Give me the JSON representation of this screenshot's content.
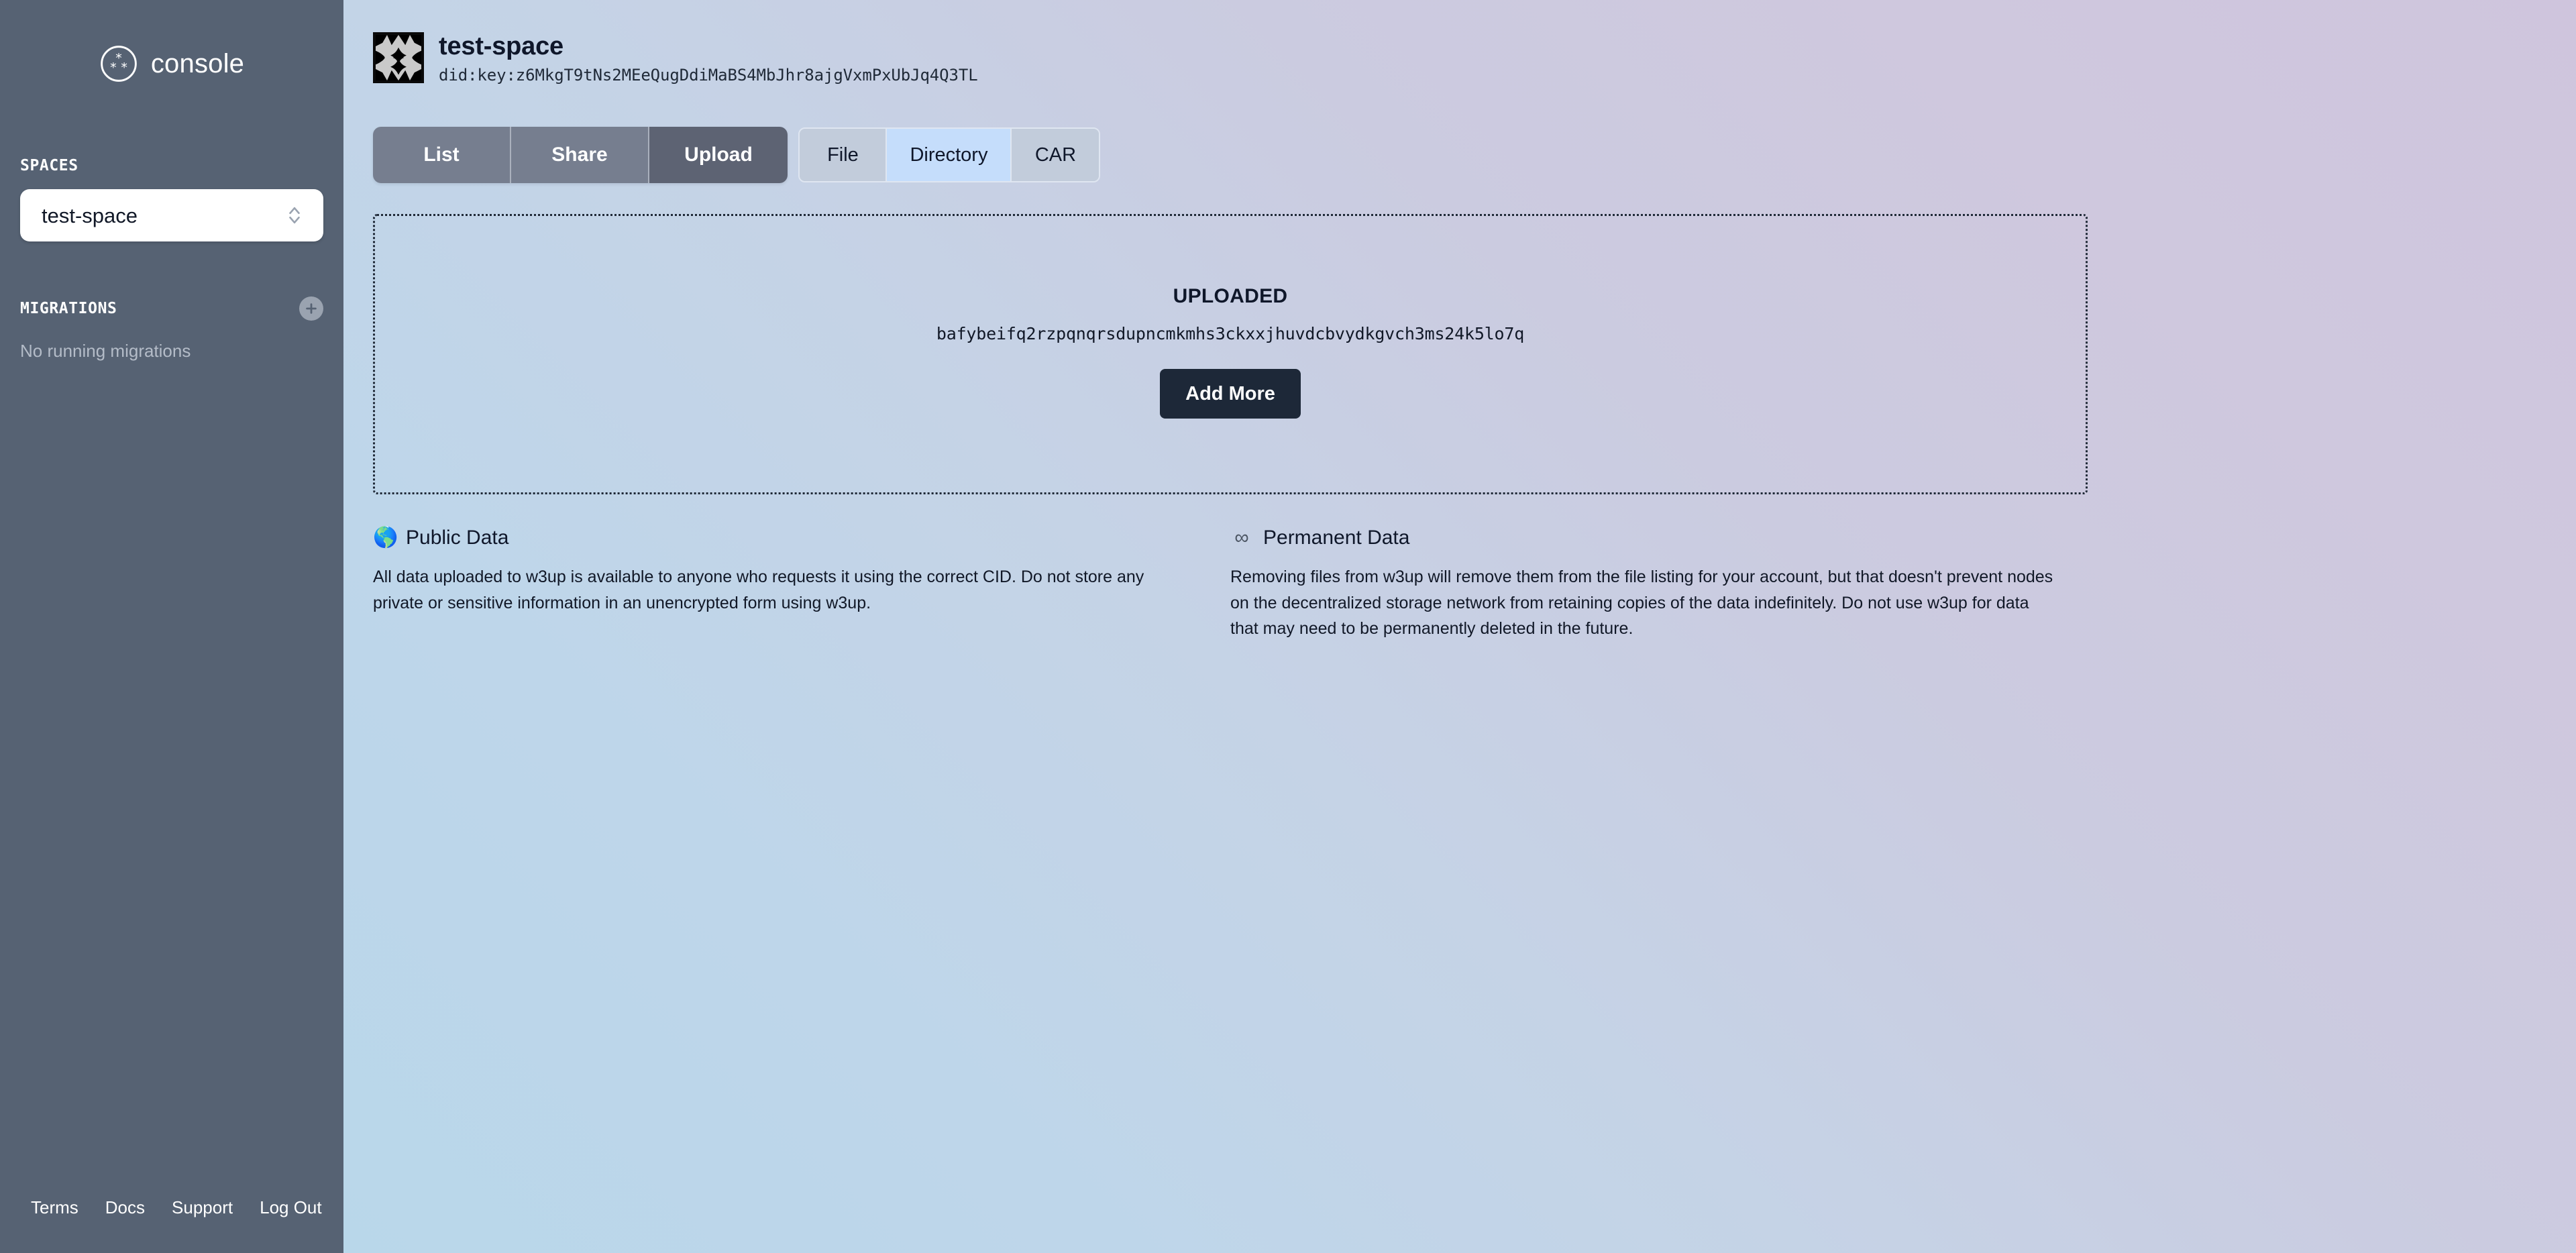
{
  "app": {
    "brand_name": "console",
    "brand_logo_icon": "asterisk-circle-logo"
  },
  "sidebar": {
    "spaces": {
      "section_label": "SPACES",
      "selected_space": "test-space",
      "chevron_icon": "chevron-up-down-icon"
    },
    "migrations": {
      "section_label": "MIGRATIONS",
      "add_icon": "plus-icon",
      "empty_text": "No running migrations"
    },
    "footer_links": [
      {
        "label": "Terms"
      },
      {
        "label": "Docs"
      },
      {
        "label": "Support"
      },
      {
        "label": "Log Out"
      }
    ]
  },
  "header": {
    "avatar_icon": "space-identicon-avatar",
    "space_name": "test-space",
    "space_did": "did:key:z6MkgT9tNs2MEeQugDdiMaBS4MbJhr8ajgVxmPxUbJq4Q3TL"
  },
  "primary_tabs": [
    {
      "label": "List",
      "active": false
    },
    {
      "label": "Share",
      "active": false
    },
    {
      "label": "Upload",
      "active": true
    }
  ],
  "secondary_tabs": [
    {
      "label": "File",
      "active": false
    },
    {
      "label": "Directory",
      "active": true
    },
    {
      "label": "CAR",
      "active": false
    }
  ],
  "dropzone": {
    "status_label": "UPLOADED",
    "cid": "bafybeifq2rzpqnqrsdupncmkmhs3ckxxjhuvdcbvydkgvch3ms24k5lo7q",
    "add_more_label": "Add More"
  },
  "info_cards": [
    {
      "icon": "globe-icon",
      "icon_glyph": "🌎",
      "title": "Public Data",
      "body": "All data uploaded to w3up is available to anyone who requests it using the correct CID. Do not store any private or sensitive information in an unencrypted form using w3up."
    },
    {
      "icon": "infinity-icon",
      "icon_glyph": "∞",
      "title": "Permanent Data",
      "body": "Removing files from w3up will remove them from the file listing for your account, but that doesn't prevent nodes on the decentralized storage network from retaining copies of the data indefinitely. Do not use w3up for data that may need to be permanently deleted in the future."
    }
  ],
  "colors": {
    "sidebar_bg": "#566273",
    "tab_inactive": "#767e8f",
    "tab_active": "#5d6373",
    "subtab_inactive": "#c2ccdb",
    "subtab_active": "#c5ddfb",
    "button_dark": "#1d2838",
    "gradient_start": "#b9d7ea",
    "gradient_end": "#cfc5dd"
  }
}
